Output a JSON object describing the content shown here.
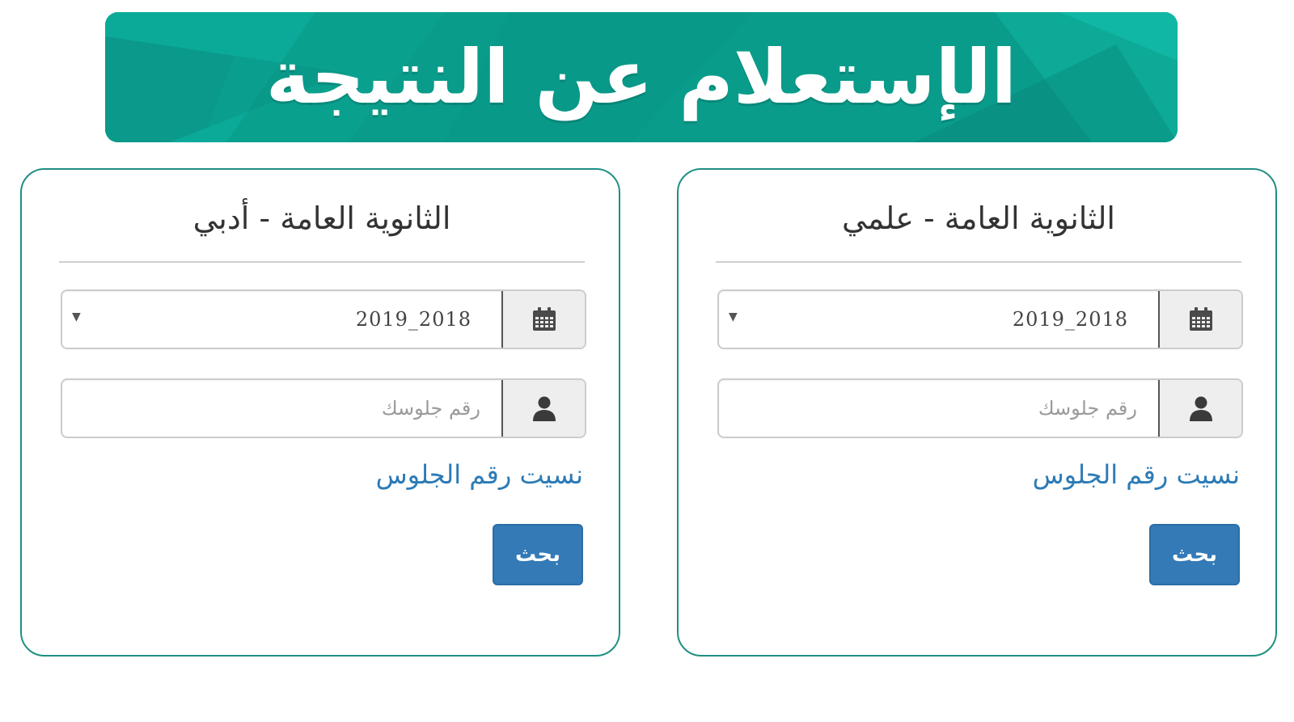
{
  "banner": {
    "title": "الإستعلام عن النتيجة"
  },
  "colors": {
    "banner_teal": "#0a9c8a",
    "card_border": "#1f8f84",
    "link_blue": "#2c7bb6",
    "button_blue": "#337ab7"
  },
  "cards": [
    {
      "title": "الثانوية العامة - علمي",
      "year_select": {
        "value": "2019_2018",
        "icon": "calendar-icon"
      },
      "seat_input": {
        "value": "",
        "placeholder": "رقم جلوسك",
        "icon": "user-icon"
      },
      "forgot_link": "نسيت رقم الجلوس",
      "search_button": "بحث"
    },
    {
      "title": "الثانوية العامة - أدبي",
      "year_select": {
        "value": "2019_2018",
        "icon": "calendar-icon"
      },
      "seat_input": {
        "value": "",
        "placeholder": "رقم جلوسك",
        "icon": "user-icon"
      },
      "forgot_link": "نسيت رقم الجلوس",
      "search_button": "بحث"
    }
  ]
}
